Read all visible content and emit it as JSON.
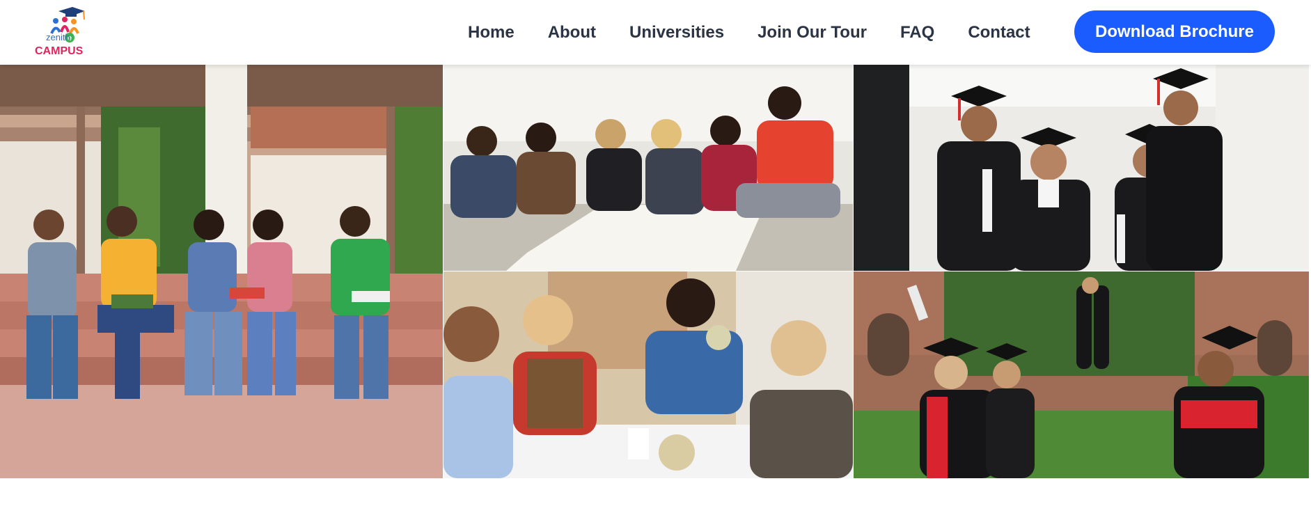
{
  "brand": {
    "logo_top": "zenith",
    "logo_bottom": "CAMPUS",
    "colors": {
      "logo_blue": "#2b6fd6",
      "logo_red": "#e0245e",
      "logo_green": "#3cb44b",
      "logo_orange": "#f7931e"
    }
  },
  "nav": {
    "items": [
      {
        "label": "Home"
      },
      {
        "label": "About"
      },
      {
        "label": "Universities"
      },
      {
        "label": "Join Our Tour"
      },
      {
        "label": "FAQ"
      },
      {
        "label": "Contact"
      }
    ],
    "cta_label": "Download Brochure"
  },
  "colors": {
    "accent": "#1a5cff",
    "nav_text": "#2b3445"
  },
  "gallery": {
    "photos": [
      {
        "icon": "students-on-steps-photo"
      },
      {
        "icon": "group-study-floor-photo"
      },
      {
        "icon": "graduates-corridor-photo"
      },
      {
        "icon": "students-lunch-photo"
      },
      {
        "icon": "graduates-high-five-photo"
      }
    ]
  }
}
